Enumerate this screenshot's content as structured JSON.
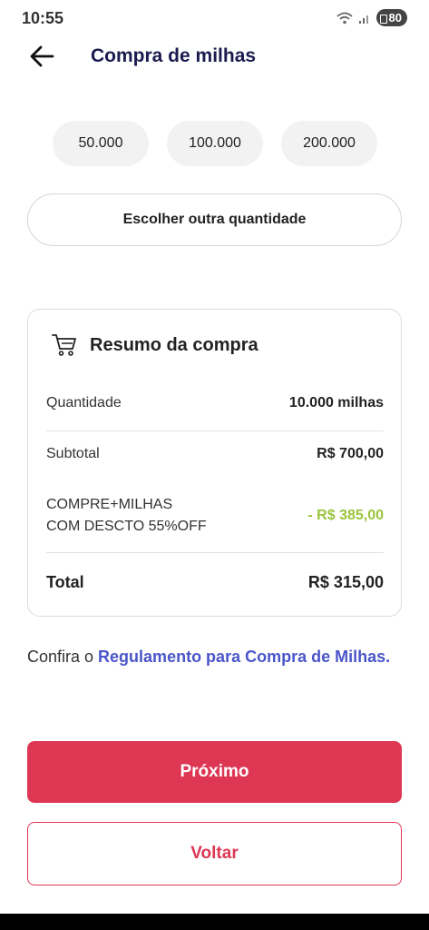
{
  "status_bar": {
    "time": "10:55",
    "battery": "80"
  },
  "header": {
    "title": "Compra de milhas",
    "back_icon": "arrow-left-icon"
  },
  "quantity_options": [
    "50.000",
    "100.000",
    "200.000"
  ],
  "other_quantity_label": "Escolher outra quantidade",
  "summary": {
    "title": "Resumo da compra",
    "icon": "cart-icon",
    "quantity_label": "Quantidade",
    "quantity_value": "10.000 milhas",
    "subtotal_label": "Subtotal",
    "subtotal_value": "R$ 700,00",
    "discount_label_line1": "COMPRE+MILHAS",
    "discount_label_line2": "COM DESCTO 55%OFF",
    "discount_value": "- R$ 385,00",
    "total_label": "Total",
    "total_value": "R$ 315,00"
  },
  "terms": {
    "prefix": "Confira o ",
    "link": "Regulamento para Compra de Milhas."
  },
  "buttons": {
    "next": "Próximo",
    "back": "Voltar"
  },
  "colors": {
    "accent": "#dd3754",
    "link": "#4a55c9",
    "discount": "#9bc43e",
    "title": "#1b1b4f"
  }
}
